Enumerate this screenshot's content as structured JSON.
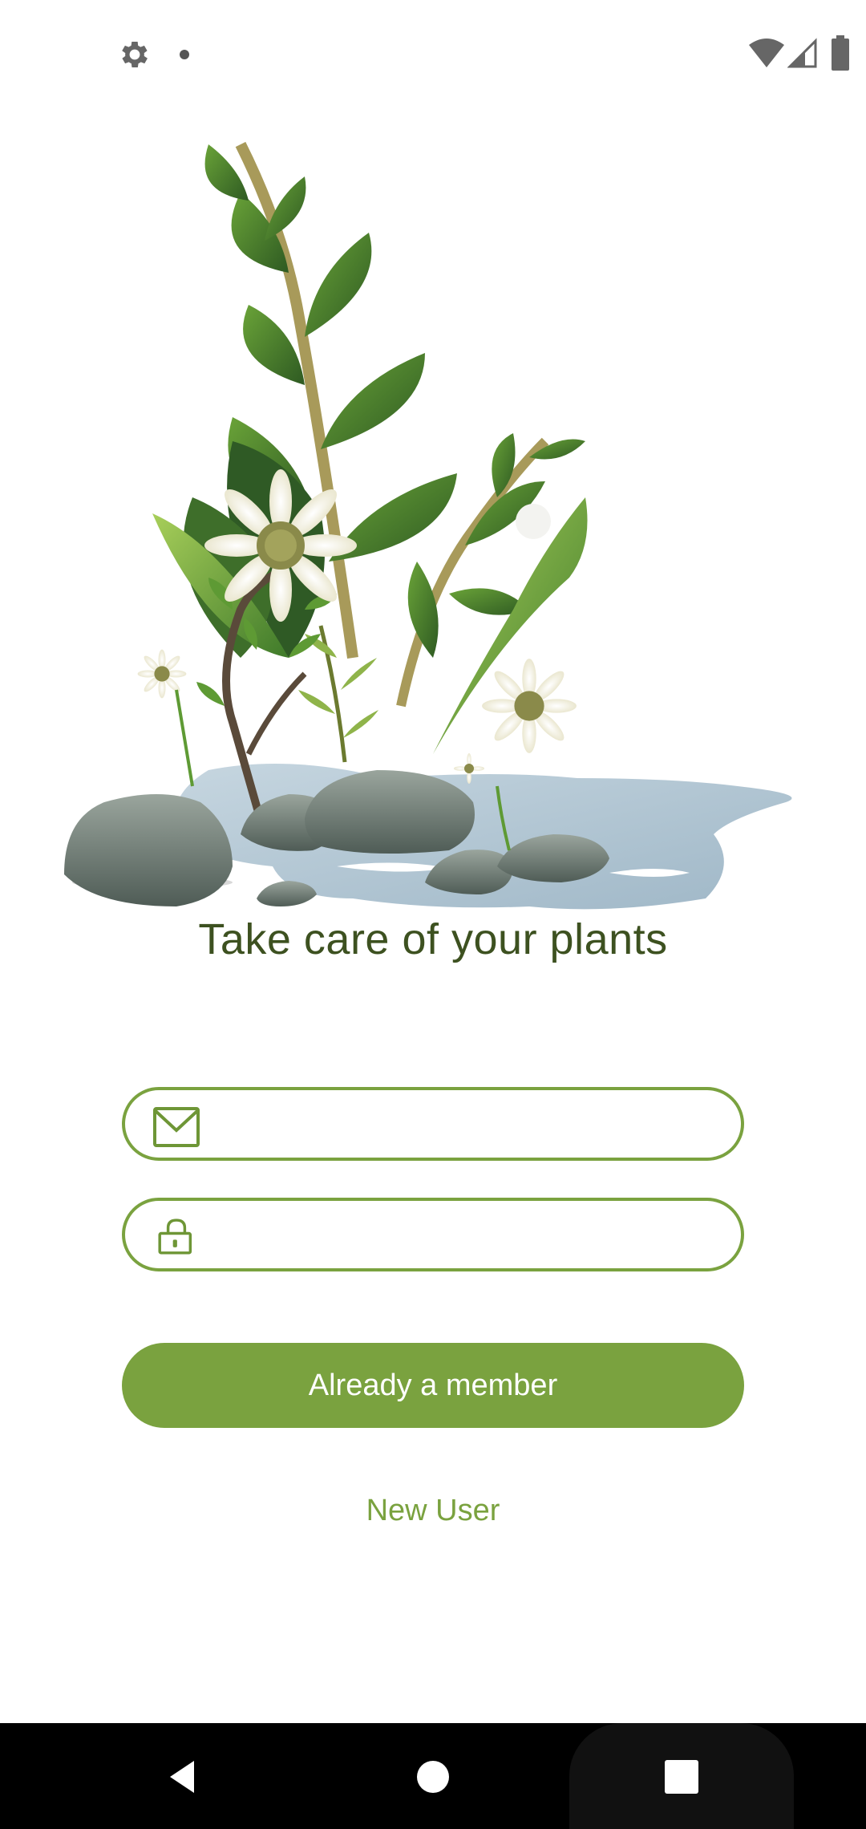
{
  "status_bar": {
    "left_icons": [
      "gear-icon",
      "notification-dot-icon"
    ],
    "right_icons": [
      "wifi-icon",
      "signal-icon",
      "battery-icon"
    ]
  },
  "hero": {
    "illustration": "plants-and-rocks-illustration"
  },
  "title": "Take care of your plants",
  "form": {
    "email": {
      "icon": "mail-icon",
      "value": "",
      "placeholder": ""
    },
    "password": {
      "icon": "lock-icon",
      "value": "",
      "placeholder": ""
    }
  },
  "buttons": {
    "login_label": "Already a member",
    "signup_label": "New User"
  },
  "colors": {
    "accent": "#7aa23f",
    "title": "#3d5120",
    "nav_bar": "#000000"
  },
  "nav_bar": {
    "buttons": [
      "back-icon",
      "home-icon",
      "recents-icon"
    ]
  }
}
